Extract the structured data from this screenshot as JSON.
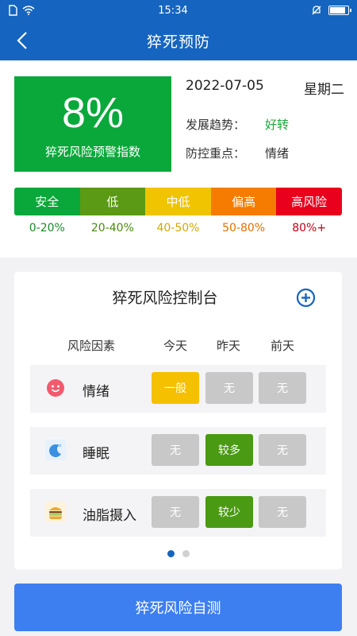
{
  "status_bar": {
    "time": "15:34"
  },
  "nav": {
    "title": "猝死预防"
  },
  "index": {
    "value": "8%",
    "label": "猝死风险预警指数"
  },
  "info": {
    "date": "2022-07-05",
    "weekday": "星期二",
    "trend_label": "发展趋势：",
    "trend_value": "好转",
    "focus_label": "防控重点：",
    "focus_value": "情绪"
  },
  "risk_scale": [
    {
      "label": "安全",
      "range": "0-20%",
      "color": "#0aa83a",
      "range_color": "#1a8a2a"
    },
    {
      "label": "低",
      "range": "20-40%",
      "color": "#5a9a14",
      "range_color": "#4a8a14"
    },
    {
      "label": "中低",
      "range": "40-50%",
      "color": "#f0c400",
      "range_color": "#d4a800"
    },
    {
      "label": "偏高",
      "range": "50-80%",
      "color": "#f57c00",
      "range_color": "#e07000"
    },
    {
      "label": "高风险",
      "range": "80%+",
      "color": "#e8001c",
      "range_color": "#c00018"
    }
  ],
  "console": {
    "title": "猝死风险控制台",
    "headers": {
      "factor": "风险因素",
      "today": "今天",
      "yesterday": "昨天",
      "day_before": "前天"
    },
    "rows": [
      {
        "name": "情绪",
        "icon": "emotion-face-icon",
        "today": "一般",
        "yesterday": "无",
        "day_before": "无"
      },
      {
        "name": "睡眠",
        "icon": "sleep-moon-icon",
        "today": "无",
        "yesterday": "较多",
        "day_before": "无"
      },
      {
        "name": "油脂摄入",
        "icon": "burger-icon",
        "today": "无",
        "yesterday": "较少",
        "day_before": "无"
      }
    ],
    "pager": {
      "current": 1,
      "total": 2
    }
  },
  "selftest_button": "猝死风险自测"
}
